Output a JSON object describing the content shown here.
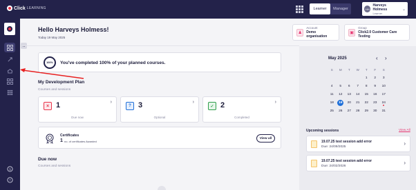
{
  "header": {
    "brand_main": "Click",
    "brand_sub": "LEARNING",
    "mode_learner": "Learner",
    "mode_manager": "Manager",
    "user_initials": "HH",
    "user_name": "Harveys Holmess",
    "user_role": "Learner"
  },
  "greeting": {
    "title": "Hello Harveys Holmess!",
    "date": "Today 19 May 2025"
  },
  "account": {
    "label": "Account",
    "value": "Demo organisation"
  },
  "group": {
    "label": "Group",
    "value": "Click2.0 Customer Care Testing"
  },
  "completion": {
    "ring": "100%",
    "message": "You've completed 100% of your planned courses."
  },
  "dev_plan": {
    "title": "My Development Plan",
    "subtitle": "Courses and sessions"
  },
  "stats": [
    {
      "value": "1",
      "label": "Due now",
      "color": "#e8334a"
    },
    {
      "value": "3",
      "label": "Optional",
      "color": "#1e6fd9"
    },
    {
      "value": "2",
      "label": "Completed",
      "color": "#2e9e4a"
    }
  ],
  "certificates": {
    "title": "Certificates",
    "count": "1",
    "desc": "no. of certificates Awarded",
    "button": "View all"
  },
  "due_now": {
    "title": "Due now",
    "subtitle": "Courses and sessions"
  },
  "calendar": {
    "month": "May 2025",
    "days": [
      "S",
      "M",
      "T",
      "W",
      "T",
      "F",
      "S"
    ],
    "weeks": [
      [
        "",
        "",
        "",
        "",
        "1",
        "2",
        "3"
      ],
      [
        "4",
        "5",
        "6",
        "7",
        "8",
        "9",
        "10"
      ],
      [
        "11",
        "12",
        "13",
        "14",
        "15",
        "16",
        "17"
      ],
      [
        "18",
        "19",
        "20",
        "21",
        "22",
        "23",
        "24"
      ],
      [
        "25",
        "26",
        "27",
        "28",
        "29",
        "30",
        "31"
      ]
    ],
    "selected": "19",
    "marked": "24"
  },
  "upcoming": {
    "title": "Upcoming sessions",
    "view_all": "View All",
    "items": [
      {
        "title": "19.07.25 test session add error",
        "due": "Due: 24/09/2025"
      },
      {
        "title": "19.07.25 test session add error",
        "due": "Due: 24/02/2026"
      }
    ]
  }
}
